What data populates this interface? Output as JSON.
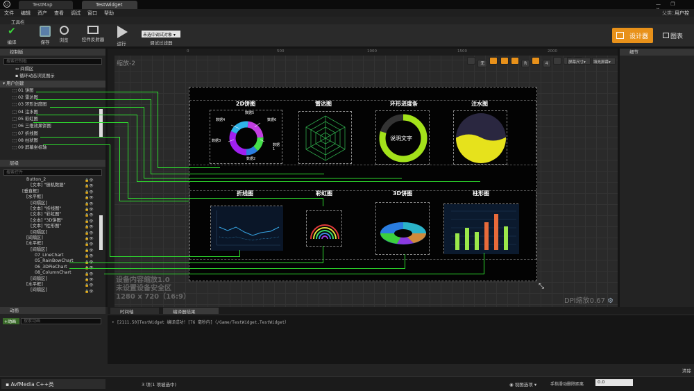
{
  "window": {
    "tabs": [
      "TestMap",
      "TestWidget"
    ],
    "parent_label": "父类：",
    "parent_value": "用户控件"
  },
  "menu": [
    "文件",
    "编辑",
    "资产",
    "查看",
    "调试",
    "窗口",
    "帮助"
  ],
  "toolbar": {
    "title": "工具栏",
    "compile": "编译",
    "save": "保存",
    "browse": "浏览",
    "reflector": "控件反射器",
    "run": "运行",
    "debug_target": "未选中调试对象",
    "debug_filter": "调试过滤器",
    "designer": "设计器",
    "graph": "图表"
  },
  "palette": {
    "title": "控制板",
    "search_placeholder": "搜索控制板",
    "items_top": [
      "间隔区",
      "循环动态浏览图示"
    ],
    "category": "用户创建",
    "items": [
      "01 饼图",
      "02 雷达图",
      "03 环形进度图",
      "04 注水图",
      "05 彩虹图",
      "06 三维效果饼图",
      "07 折线图",
      "08 柱状图",
      "09 屏幕坐标轴"
    ]
  },
  "hierarchy": {
    "title": "层级",
    "search_placeholder": "搜索控件",
    "items": [
      "Button_2",
      "[文本] \"随机数据\"",
      "[垂直框]",
      "[水平框]",
      "[间隔区]",
      "[文本] \"折线图\"",
      "[文本] \"彩虹图\"",
      "[文本] \"3D饼图\"",
      "[文本] \"柱形图\"",
      "[间隔区]",
      "[间隔区]",
      "[水平框]",
      "[间隔区]",
      "07_LineChart",
      "05_RainBowChart",
      "06_3DPieChart",
      "08_ColumnChart",
      "[间隔区]",
      "[水平框]",
      "[间隔区]"
    ]
  },
  "designer": {
    "zoom": "缩放-2",
    "ruler": [
      "0",
      "500",
      "1000",
      "1500",
      "2000"
    ],
    "btn_none": "无",
    "btn_r": "R",
    "btn_4": "4",
    "screen_size": "屏幕尺寸",
    "fill_screen": "填充屏幕",
    "device_text1": "设备内容缩放1.0",
    "device_text2": "未设置设备安全区",
    "device_res": "1280 x 720（16:9）",
    "dpi": "DPI缩放0.67"
  },
  "widget": {
    "row1": [
      "2D饼图",
      "雷达图",
      "环形进度条",
      "注水图"
    ],
    "row2": [
      "折线图",
      "彩虹图",
      "3D饼图",
      "柱形图"
    ],
    "pie_labels": [
      "数据1",
      "数据2",
      "数据3",
      "数据4",
      "数据5",
      "数据6"
    ],
    "ring_text": "说明文字"
  },
  "details": {
    "title": "细节"
  },
  "bottom": {
    "anim_title": "动画",
    "add": "+动画",
    "anim_search": "搜索动画",
    "timeline": "时间轴",
    "compiler": "编译器结果",
    "log": "[2111.50]TestWidget 编译成功！[76 毫秒内]（/Game/TestWidget.TestWidget）",
    "clear": "清除"
  },
  "status": {
    "left": "AvfMedia C++类",
    "selected": "3 项(1 项被选中)",
    "view_options": "视图选项",
    "scroll_label": "手指滑动删除距离",
    "scroll_value": "0.0"
  },
  "colors": {
    "accent": "#e8911a",
    "line": "#2ee02e"
  }
}
